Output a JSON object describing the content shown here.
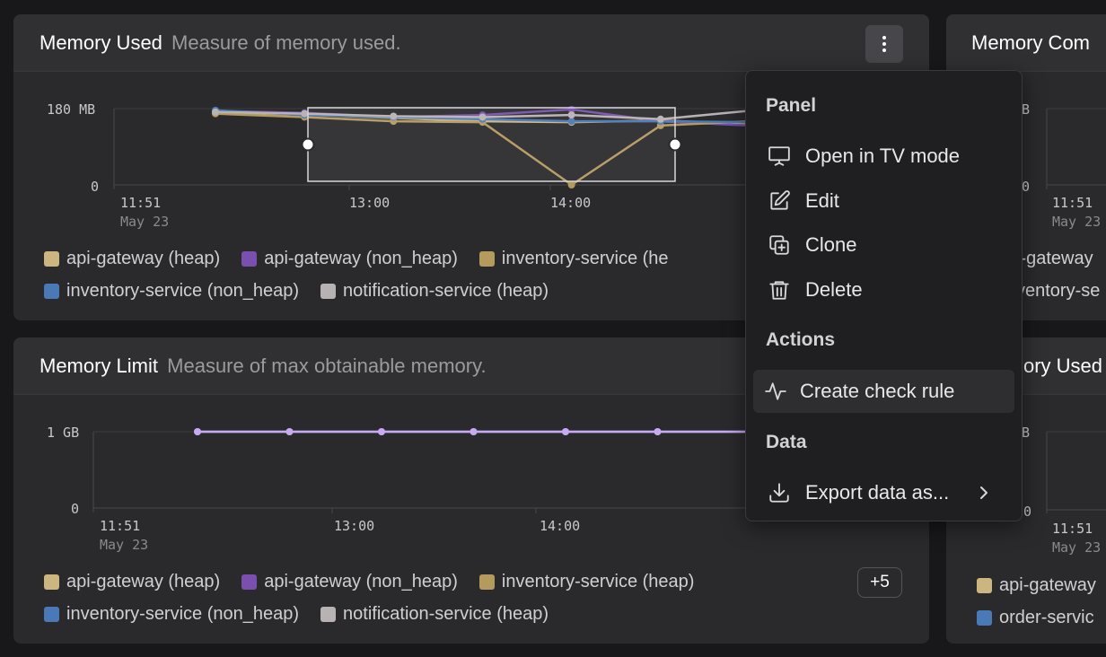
{
  "panels": {
    "memory_used": {
      "title": "Memory Used",
      "description": "Measure of memory used.",
      "y_ticks": [
        "180 MB",
        "0"
      ],
      "x_ticks": [
        "11:51",
        "13:00",
        "14:00"
      ],
      "x_sub": "May 23"
    },
    "memory_limit": {
      "title": "Memory Limit",
      "description": "Measure of max obtainable memory.",
      "y_ticks": [
        "1 GB",
        "0"
      ],
      "x_ticks": [
        "11:51",
        "13:00",
        "14:00"
      ],
      "x_sub": "May 23",
      "more_label": "+5"
    },
    "memory_committed_partial": {
      "title": "Memory Com",
      "y_ticks": [
        "B",
        "0"
      ],
      "x_ticks": [
        "11:51"
      ],
      "x_sub": "May 23",
      "legend": [
        "i-gateway",
        "ventory-se"
      ]
    },
    "memory_used_partial": {
      "title": "ory Used",
      "y_ticks": [
        "B",
        "0"
      ],
      "x_ticks": [
        "11:51"
      ],
      "x_sub": "May 23",
      "legend": [
        "api-gateway",
        "order-servic"
      ]
    }
  },
  "legend": {
    "row1": [
      "api-gateway (heap)",
      "api-gateway (non_heap)",
      "inventory-service (heap)"
    ],
    "row1_cut": [
      "api-gateway (heap)",
      "api-gateway (non_heap)",
      "inventory-service (he"
    ],
    "row2": [
      "inventory-service (non_heap)",
      "notification-service (heap)"
    ]
  },
  "colors": {
    "api_gateway_heap": "#cdb57f",
    "api_gateway_non_heap": "#7a4fae",
    "inventory_service_heap": "#b59a5e",
    "inventory_service_non_heap": "#4a79b8",
    "notification_service_heap": "#b9b2b2",
    "highlight_series": "#c9a9ef"
  },
  "menu": {
    "sections": {
      "panel": "Panel",
      "actions": "Actions",
      "data": "Data"
    },
    "items": {
      "open_tv": "Open in TV mode",
      "edit": "Edit",
      "clone": "Clone",
      "delete": "Delete",
      "create_check_rule": "Create check rule",
      "export": "Export data as..."
    },
    "icons": {
      "open_tv": "presentation-icon",
      "edit": "edit-icon",
      "clone": "clone-icon",
      "delete": "trash-icon",
      "create_check_rule": "activity-icon",
      "export": "download-icon",
      "submenu": "chevron-right-icon"
    }
  },
  "chart_data": [
    {
      "type": "line",
      "panel": "Memory Used",
      "x": [
        "11:51",
        "13:00",
        "14:00"
      ],
      "ylabel": "",
      "ylim": [
        0,
        180
      ],
      "y_unit": "MB",
      "series": [
        {
          "name": "api-gateway (heap)",
          "values": [
            170,
            166,
            158,
            150,
            148,
            152,
            144
          ]
        },
        {
          "name": "api-gateway (non_heap)",
          "values": [
            175,
            170,
            160,
            165,
            178,
            150,
            140
          ]
        },
        {
          "name": "inventory-service (heap)",
          "values": [
            168,
            160,
            150,
            148,
            0,
            140,
            150
          ]
        },
        {
          "name": "inventory-service (non_heap)",
          "values": [
            176,
            165,
            160,
            155,
            150,
            150,
            148
          ]
        },
        {
          "name": "notification-service (heap)",
          "values": [
            172,
            168,
            162,
            160,
            165,
            155,
            175
          ]
        }
      ],
      "selection": {
        "from": "12:51",
        "to": "14:48"
      }
    },
    {
      "type": "line",
      "panel": "Memory Limit",
      "x": [
        "11:51",
        "13:00",
        "14:00"
      ],
      "ylabel": "",
      "ylim": [
        0,
        1
      ],
      "y_unit": "GB",
      "series": [
        {
          "name": "api-gateway (heap)",
          "values": [
            1,
            1,
            1,
            1,
            1,
            1,
            1
          ]
        },
        {
          "name": "api-gateway (non_heap)",
          "values": [
            1,
            1,
            1,
            1,
            1,
            1,
            1
          ]
        },
        {
          "name": "inventory-service (non_heap)",
          "values": [
            1,
            1,
            1,
            1,
            1,
            1,
            1
          ]
        }
      ]
    }
  ]
}
